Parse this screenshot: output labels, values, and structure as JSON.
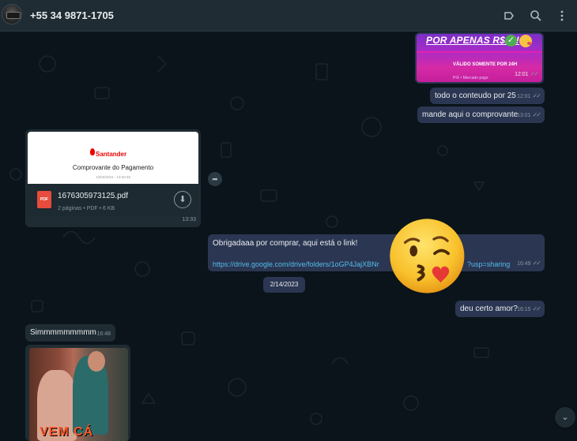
{
  "header": {
    "contact_name": "+55 34 9871-1705"
  },
  "messages": {
    "promo": {
      "headline": "POR APENAS R$25!",
      "subline": "VÁLIDO SOMENTE POR 24H",
      "payment_text": "PIX • Mercado pago",
      "time": "12:01"
    },
    "msg1": {
      "text": "todo o conteudo por 25",
      "time": "12:01"
    },
    "msg2": {
      "text": "mande aqui o comprovante",
      "time": "13:01"
    },
    "pdf": {
      "brand": "Santander",
      "doc_title": "Comprovante do Pagamento",
      "doc_date": "13/02/2023 - 13:32:45",
      "badge": "PDF",
      "file_name": "1676305973125.pdf",
      "file_meta": "2 páginas • PDF • 6 KB",
      "time": "13:33"
    },
    "link_msg": {
      "text": "Obrigadaaa por comprar, aqui está o link!",
      "url_start": "https://drive.google.com/drive/folders/1oGP4JajXBNr",
      "url_end": "?usp=sharing",
      "time": "16:49"
    },
    "date_separator": "2/14/2023",
    "msg3": {
      "text": "deu certo amor?",
      "time": "16:15"
    },
    "msg4": {
      "text": "Simmmmmmmmm",
      "time": "16:48"
    },
    "gif": {
      "caption": "VEM CÁ"
    }
  },
  "icons": {
    "label": "label-icon",
    "search": "search-icon",
    "menu": "menu-icon",
    "forward": "forward-icon",
    "download": "download-icon",
    "scroll": "chevron-down-icon",
    "emoji": "kiss-emoji"
  },
  "colors": {
    "outgoing_bubble": "#2b3652",
    "incoming_bubble": "#202c33",
    "link": "#53bdeb",
    "header": "#202c33"
  }
}
